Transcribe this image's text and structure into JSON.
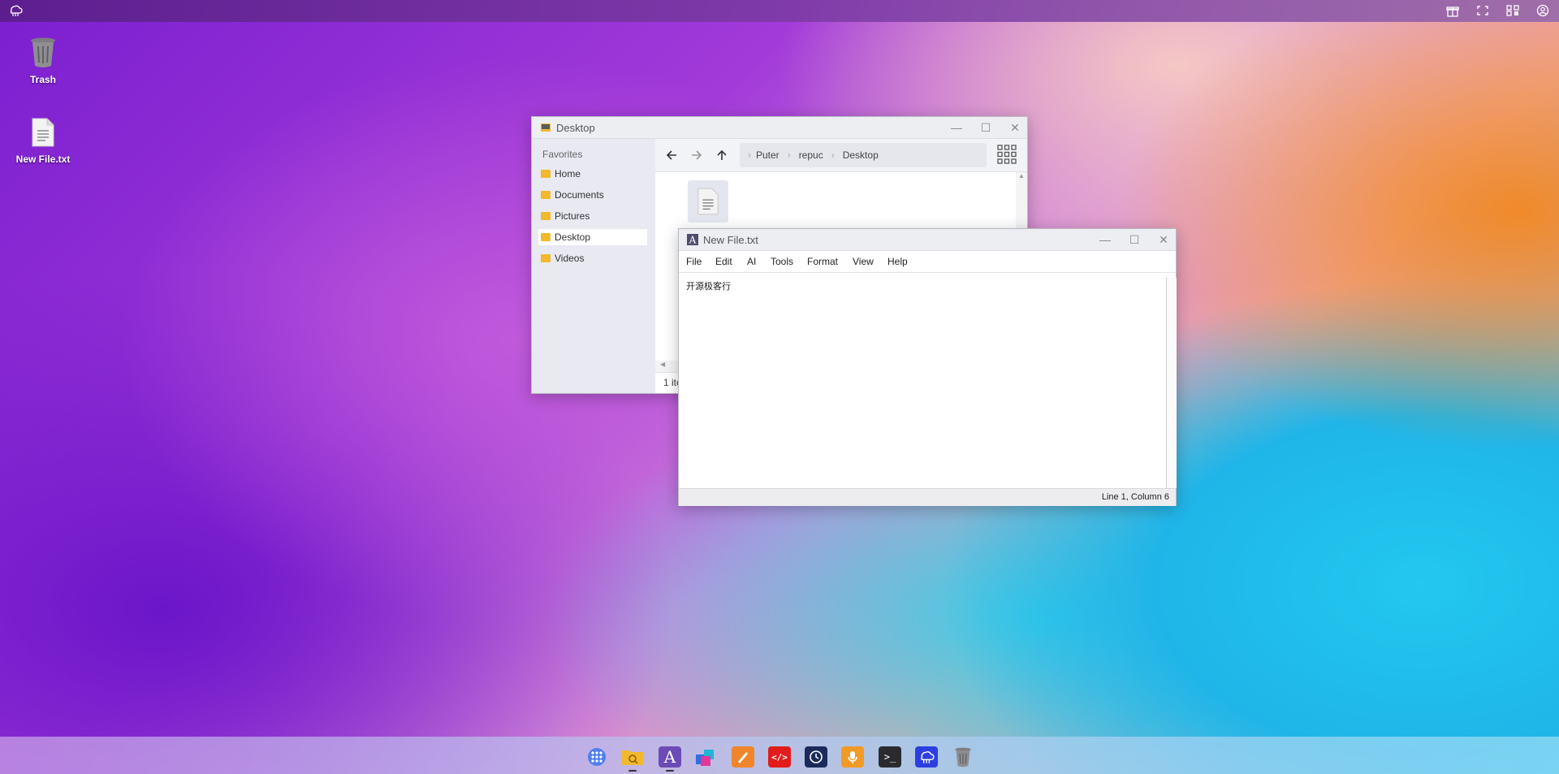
{
  "desktop": {
    "icons": [
      {
        "label": "Trash",
        "icon": "trash-icon"
      },
      {
        "label": "New File.txt",
        "icon": "text-file-icon"
      }
    ]
  },
  "topbar": {
    "icons": [
      "puter-logo-icon",
      "gift-icon",
      "fullscreen-icon",
      "qr-code-icon",
      "user-icon"
    ]
  },
  "explorer": {
    "title": "Desktop",
    "favorites_heading": "Favorites",
    "favorites": [
      {
        "label": "Home"
      },
      {
        "label": "Documents"
      },
      {
        "label": "Pictures"
      },
      {
        "label": "Desktop",
        "active": true
      },
      {
        "label": "Videos"
      }
    ],
    "breadcrumb": [
      "Puter",
      "repuc",
      "Desktop"
    ],
    "status": "1 ite"
  },
  "editor": {
    "title": "New File.txt",
    "menu": [
      "File",
      "Edit",
      "AI",
      "Tools",
      "Format",
      "View",
      "Help"
    ],
    "content": "开源极客行",
    "status": "Line 1, Column 6"
  },
  "dock": {
    "apps": [
      "app-center-icon",
      "file-explorer-icon",
      "editor-icon",
      "dev-center-icon",
      "draw-icon",
      "code-icon",
      "camera-icon",
      "recorder-icon",
      "terminal-icon",
      "puter-icon",
      "trash-icon"
    ]
  },
  "colors": {
    "folder": "#f1b92b",
    "title_bar": "#eceef2",
    "sidebar": "#e8e9f1"
  }
}
